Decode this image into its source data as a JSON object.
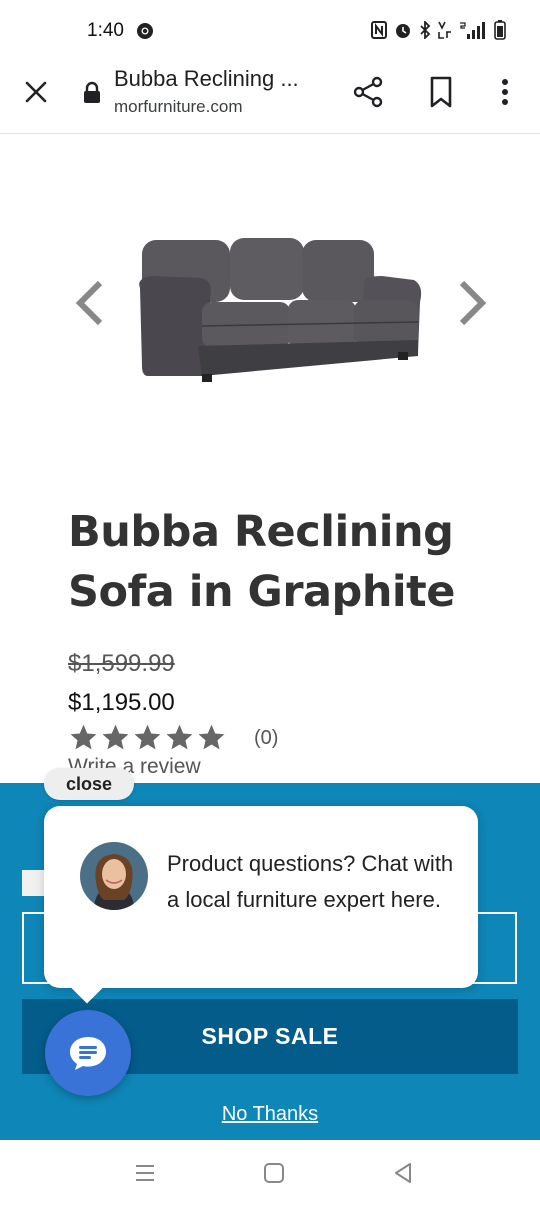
{
  "status_bar": {
    "time": "1:40",
    "icons": [
      "chrome-icon",
      "nfc-icon",
      "alarm-icon",
      "bluetooth-icon",
      "volte-icon",
      "5g-signal-icon",
      "battery-icon"
    ]
  },
  "browser": {
    "page_title": "Bubba Reclining ...",
    "url": "morfurniture.com",
    "icons": [
      "close-icon",
      "lock-icon",
      "share-icon",
      "bookmark-icon",
      "more-vert-icon"
    ]
  },
  "product": {
    "title": "Bubba Reclining Sofa in Graphite",
    "original_price": "$1,599.99",
    "sale_price": "$1,195.00",
    "rating": 0,
    "max_rating": 5,
    "review_count": "(0)",
    "write_review": "Write a review"
  },
  "promo": {
    "shop_button": "SHOP SALE",
    "no_thanks": "No Thanks",
    "background_color": "#0e86b7",
    "button_color": "#045c8a"
  },
  "chat": {
    "close_label": "close",
    "message": "Product questions? Chat with a local furniture expert here.",
    "fab_color": "#3a73d8"
  },
  "nav_bar": {
    "icons": [
      "recent-apps-icon",
      "home-icon",
      "back-icon"
    ]
  }
}
